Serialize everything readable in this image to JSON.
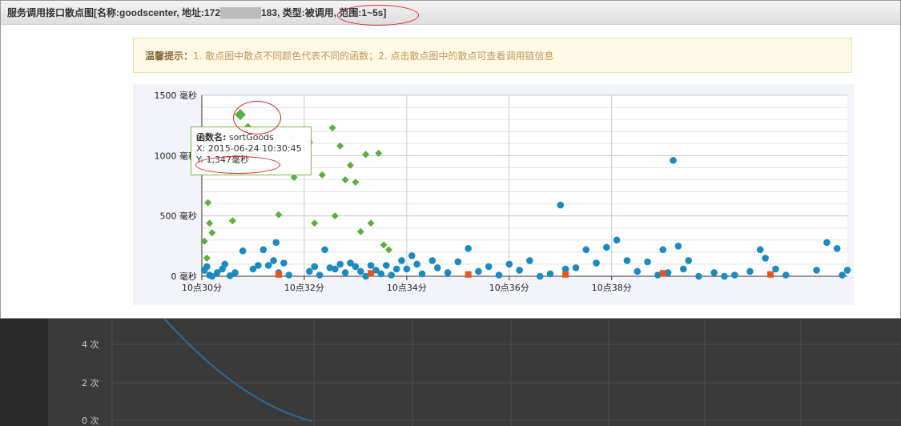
{
  "window": {
    "title_prefix": "服务调用接口散点图[名称:goodscenter, 地址:172",
    "title_masked": "██████",
    "title_suffix": "183, 类型:被调用, 范围:1~5s]"
  },
  "tip": {
    "label": "温馨提示：",
    "text": "1. 散点图中散点不同颜色代表不同的函数；2. 点击散点图中的散点可查看调用链信息"
  },
  "tooltip": {
    "func_label": "函数名:",
    "func_value": "sortGoods",
    "x_label": "X:",
    "x_value": "2015-06-24 10:30:45",
    "y_label": "Y:",
    "y_value": "1,347毫秒"
  },
  "colors": {
    "green": "#5ab03c",
    "blue": "#1a8bc2",
    "orange": "#e9541e"
  },
  "chart_data": {
    "type": "scatter",
    "yticks": [
      "0 毫秒",
      "500 毫秒",
      "1000 毫秒",
      "1500 毫秒"
    ],
    "ylim": [
      0,
      1500
    ],
    "xticks": [
      "10点30分",
      "10点32分",
      "10点34分",
      "10点36分",
      "10点38分"
    ],
    "xlim": [
      0,
      10
    ],
    "grid": true,
    "series": [
      {
        "marker": "diamond",
        "color": "green",
        "points": [
          [
            0.05,
            290
          ],
          [
            0.1,
            150
          ],
          [
            0.12,
            610
          ],
          [
            0.15,
            440
          ],
          [
            0.2,
            360
          ],
          [
            0.35,
            1190
          ],
          [
            0.6,
            460
          ],
          [
            0.75,
            1340
          ],
          [
            0.9,
            1240
          ],
          [
            1.1,
            1110
          ],
          [
            1.3,
            1090
          ],
          [
            1.5,
            510
          ],
          [
            1.75,
            1150
          ],
          [
            1.8,
            820
          ],
          [
            2.1,
            1110
          ],
          [
            2.2,
            440
          ],
          [
            2.35,
            840
          ],
          [
            2.55,
            1230
          ],
          [
            2.6,
            500
          ],
          [
            2.7,
            1080
          ],
          [
            2.8,
            800
          ],
          [
            2.9,
            920
          ],
          [
            3.0,
            780
          ],
          [
            3.1,
            370
          ],
          [
            3.2,
            1010
          ],
          [
            3.3,
            440
          ],
          [
            3.45,
            1020
          ],
          [
            3.55,
            260
          ],
          [
            3.65,
            220
          ]
        ]
      },
      {
        "marker": "circle",
        "color": "blue",
        "points": [
          [
            0.05,
            50
          ],
          [
            0.1,
            80
          ],
          [
            0.15,
            10
          ],
          [
            0.2,
            0
          ],
          [
            0.3,
            30
          ],
          [
            0.4,
            60
          ],
          [
            0.45,
            100
          ],
          [
            0.55,
            5
          ],
          [
            0.65,
            30
          ],
          [
            0.8,
            210
          ],
          [
            1.0,
            60
          ],
          [
            1.1,
            90
          ],
          [
            1.2,
            220
          ],
          [
            1.3,
            90
          ],
          [
            1.4,
            130
          ],
          [
            1.45,
            280
          ],
          [
            1.5,
            30
          ],
          [
            1.6,
            110
          ],
          [
            1.7,
            10
          ],
          [
            2.0,
            1060
          ],
          [
            2.1,
            40
          ],
          [
            2.2,
            80
          ],
          [
            2.3,
            10
          ],
          [
            2.4,
            220
          ],
          [
            2.5,
            70
          ],
          [
            2.6,
            60
          ],
          [
            2.7,
            100
          ],
          [
            2.8,
            30
          ],
          [
            2.9,
            110
          ],
          [
            3.0,
            80
          ],
          [
            3.1,
            40
          ],
          [
            3.2,
            0
          ],
          [
            3.3,
            90
          ],
          [
            3.4,
            50
          ],
          [
            3.5,
            20
          ],
          [
            3.6,
            90
          ],
          [
            3.7,
            10
          ],
          [
            3.8,
            60
          ],
          [
            3.9,
            130
          ],
          [
            4.0,
            60
          ],
          [
            4.1,
            170
          ],
          [
            4.2,
            100
          ],
          [
            4.3,
            20
          ],
          [
            4.5,
            130
          ],
          [
            4.6,
            70
          ],
          [
            4.8,
            30
          ],
          [
            5.0,
            120
          ],
          [
            5.2,
            230
          ],
          [
            5.4,
            40
          ],
          [
            5.6,
            80
          ],
          [
            5.8,
            10
          ],
          [
            6.0,
            100
          ],
          [
            6.2,
            50
          ],
          [
            6.4,
            130
          ],
          [
            6.6,
            0
          ],
          [
            6.8,
            20
          ],
          [
            7.0,
            590
          ],
          [
            7.1,
            60
          ],
          [
            7.3,
            70
          ],
          [
            7.5,
            220
          ],
          [
            7.7,
            110
          ],
          [
            7.9,
            240
          ],
          [
            8.1,
            300
          ],
          [
            8.3,
            130
          ],
          [
            8.5,
            40
          ],
          [
            8.7,
            120
          ],
          [
            8.9,
            10
          ],
          [
            9.0,
            220
          ],
          [
            9.1,
            30
          ],
          [
            9.2,
            960
          ],
          [
            9.3,
            250
          ],
          [
            9.4,
            60
          ],
          [
            9.5,
            130
          ],
          [
            9.7,
            0
          ],
          [
            10.0,
            30
          ],
          [
            10.2,
            0
          ],
          [
            10.4,
            10
          ],
          [
            10.7,
            40
          ],
          [
            10.9,
            220
          ],
          [
            11.0,
            150
          ],
          [
            11.2,
            60
          ],
          [
            11.4,
            10
          ],
          [
            12.0,
            50
          ],
          [
            12.2,
            280
          ],
          [
            12.4,
            230
          ],
          [
            12.5,
            10
          ],
          [
            12.6,
            50
          ]
        ]
      },
      {
        "marker": "square",
        "color": "orange",
        "points": [
          [
            1.5,
            15
          ],
          [
            3.3,
            25
          ],
          [
            5.2,
            15
          ],
          [
            7.1,
            15
          ],
          [
            9.0,
            25
          ],
          [
            11.1,
            15
          ]
        ]
      }
    ]
  }
}
